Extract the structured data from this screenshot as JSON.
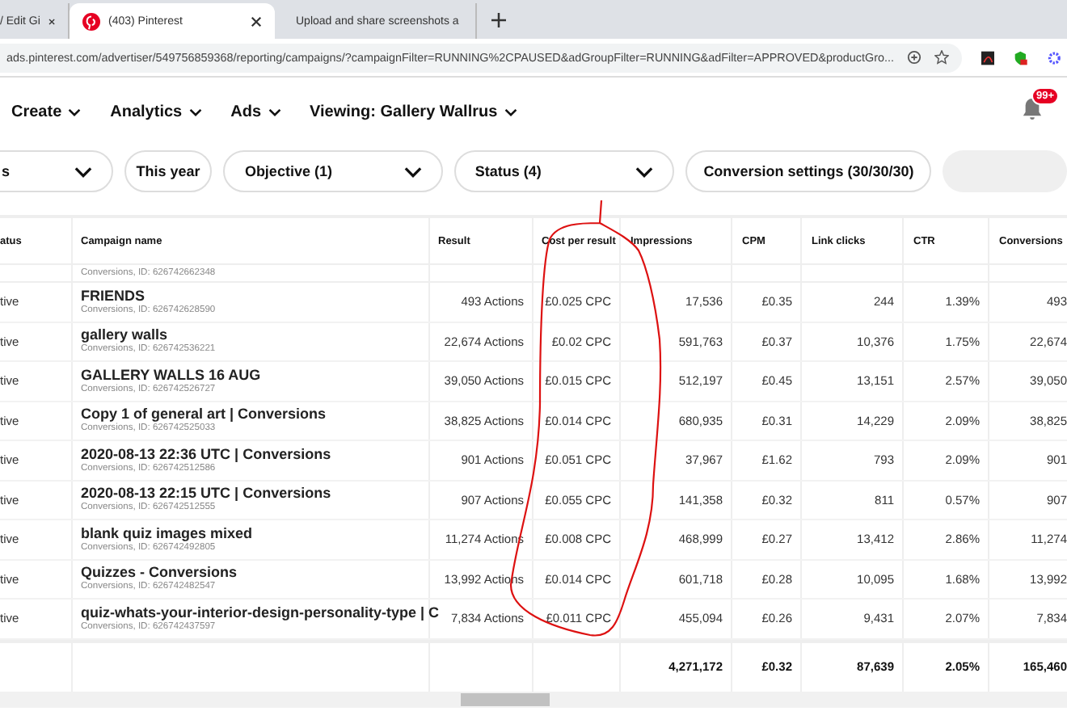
{
  "browser": {
    "tabs": [
      {
        "title": "/ Edit Gi",
        "selected": false
      },
      {
        "title": "(403) Pinterest",
        "selected": true
      },
      {
        "title": "Upload and share screenshots a",
        "selected": false
      }
    ],
    "url": "ads.pinterest.com/advertiser/549756859368/reporting/campaigns/?campaignFilter=RUNNING%2CPAUSED&adGroupFilter=RUNNING&adFilter=APPROVED&productGro..."
  },
  "nav": {
    "items": [
      "Create",
      "Analytics",
      "Ads",
      "Viewing: Gallery Wallrus"
    ],
    "notification_badge": "99+"
  },
  "filters": [
    {
      "label": "s",
      "dropdown": true
    },
    {
      "label": "This year",
      "dropdown": false
    },
    {
      "label": "Objective (1)",
      "dropdown": true
    },
    {
      "label": "Status (4)",
      "dropdown": true
    },
    {
      "label": "Conversion settings (30/30/30)",
      "dropdown": false
    }
  ],
  "table": {
    "columns": [
      "atus",
      "Campaign name",
      "Result",
      "Cost per result",
      "Impressions",
      "CPM",
      "Link clicks",
      "CTR",
      "Conversions"
    ],
    "top_partial_id": "Conversions, ID: 626742662348",
    "rows": [
      {
        "status": "tive",
        "name": "FRIENDS",
        "id": "Conversions, ID: 626742628590",
        "result": "493 Actions",
        "cost": "£0.025 CPC",
        "impressions": "17,536",
        "cpm": "£0.35",
        "clicks": "244",
        "ctr": "1.39%",
        "conversions": "493"
      },
      {
        "status": "tive",
        "name": "gallery walls",
        "id": "Conversions, ID: 626742536221",
        "result": "22,674 Actions",
        "cost": "£0.02 CPC",
        "impressions": "591,763",
        "cpm": "£0.37",
        "clicks": "10,376",
        "ctr": "1.75%",
        "conversions": "22,674"
      },
      {
        "status": "tive",
        "name": "GALLERY WALLS 16 AUG",
        "id": "Conversions, ID: 626742526727",
        "result": "39,050 Actions",
        "cost": "£0.015 CPC",
        "impressions": "512,197",
        "cpm": "£0.45",
        "clicks": "13,151",
        "ctr": "2.57%",
        "conversions": "39,050"
      },
      {
        "status": "tive",
        "name": "Copy 1 of general art | Conversions",
        "id": "Conversions, ID: 626742525033",
        "result": "38,825 Actions",
        "cost": "£0.014 CPC",
        "impressions": "680,935",
        "cpm": "£0.31",
        "clicks": "14,229",
        "ctr": "2.09%",
        "conversions": "38,825"
      },
      {
        "status": "tive",
        "name": "2020-08-13 22:36 UTC | Conversions",
        "id": "Conversions, ID: 626742512586",
        "result": "901 Actions",
        "cost": "£0.051 CPC",
        "impressions": "37,967",
        "cpm": "£1.62",
        "clicks": "793",
        "ctr": "2.09%",
        "conversions": "901"
      },
      {
        "status": "tive",
        "name": "2020-08-13 22:15 UTC | Conversions",
        "id": "Conversions, ID: 626742512555",
        "result": "907 Actions",
        "cost": "£0.055 CPC",
        "impressions": "141,358",
        "cpm": "£0.32",
        "clicks": "811",
        "ctr": "0.57%",
        "conversions": "907"
      },
      {
        "status": "tive",
        "name": "blank quiz images mixed",
        "id": "Conversions, ID: 626742492805",
        "result": "11,274 Actions",
        "cost": "£0.008 CPC",
        "impressions": "468,999",
        "cpm": "£0.27",
        "clicks": "13,412",
        "ctr": "2.86%",
        "conversions": "11,274"
      },
      {
        "status": "tive",
        "name": "Quizzes - Conversions",
        "id": "Conversions, ID: 626742482547",
        "result": "13,992 Actions",
        "cost": "£0.014 CPC",
        "impressions": "601,718",
        "cpm": "£0.28",
        "clicks": "10,095",
        "ctr": "1.68%",
        "conversions": "13,992"
      },
      {
        "status": "tive",
        "name": "quiz-whats-your-interior-design-personality-type | C",
        "id": "Conversions, ID: 626742437597",
        "result": "7,834 Actions",
        "cost": "£0.011 CPC",
        "impressions": "455,094",
        "cpm": "£0.26",
        "clicks": "9,431",
        "ctr": "2.07%",
        "conversions": "7,834"
      }
    ],
    "totals": {
      "impressions": "4,271,172",
      "cpm": "£0.32",
      "clicks": "87,639",
      "ctr": "2.05%",
      "conversions": "165,460"
    }
  }
}
